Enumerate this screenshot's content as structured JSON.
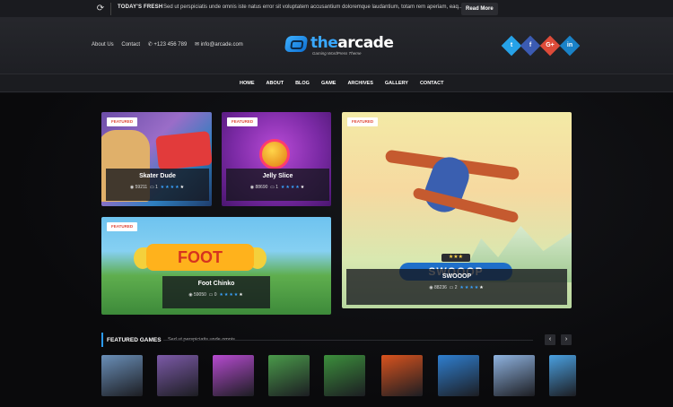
{
  "ticker": {
    "label": "TODAY'S FRESH",
    "text": "Sed ut perspiciatis unde omnis iste natus error sit voluptatem accusantium doloremque laudantium, totam rem aperiam, eaq...",
    "read_more": "Read More"
  },
  "header": {
    "about": "About Us",
    "contact": "Contact",
    "phone": "+123 456 789",
    "email": "info@arcade.com",
    "logo_prefix": "the",
    "logo_main": "arcade",
    "tagline": "Gaming WordPress Theme",
    "social": [
      "twitter-icon",
      "facebook-icon",
      "google-plus-icon",
      "linkedin-icon"
    ]
  },
  "nav": [
    "HOME",
    "ABOUT",
    "BLOG",
    "GAME",
    "ARCHIVES",
    "GALLERY",
    "CONTACT"
  ],
  "cards": [
    {
      "badge": "FEATURED",
      "title": "Skater Dude",
      "views": "59211",
      "comments": "1",
      "rating": 4
    },
    {
      "badge": "FEATURED",
      "title": "Jelly Slice",
      "views": "88690",
      "comments": "1",
      "rating": 4
    },
    {
      "badge": "FEATURED",
      "title": "SWOOOP",
      "views": "88236",
      "comments": "2",
      "rating": 4,
      "logo_text": "SWOOOP"
    },
    {
      "badge": "FEATURED",
      "title": "Foot Chinko",
      "views": "59050",
      "comments": "0",
      "rating": 4,
      "logo_text": "FOOT"
    }
  ],
  "featured": {
    "title": "FEATURED GAMES",
    "subtitle": "Sed ut perspiciatis unde omnis",
    "prev": "‹",
    "next": "›",
    "thumb_colors": [
      "#6a8fb8",
      "#7c5aa8",
      "#b64bd0",
      "#4a9a4a",
      "#3c8f3c",
      "#d9531e",
      "#2f7fd0",
      "#8fb3e0",
      "#4aa0e0"
    ]
  },
  "colors": {
    "accent": "#2b9af3",
    "badge_text": "#e04b3b",
    "star": "#3aa3ff"
  }
}
